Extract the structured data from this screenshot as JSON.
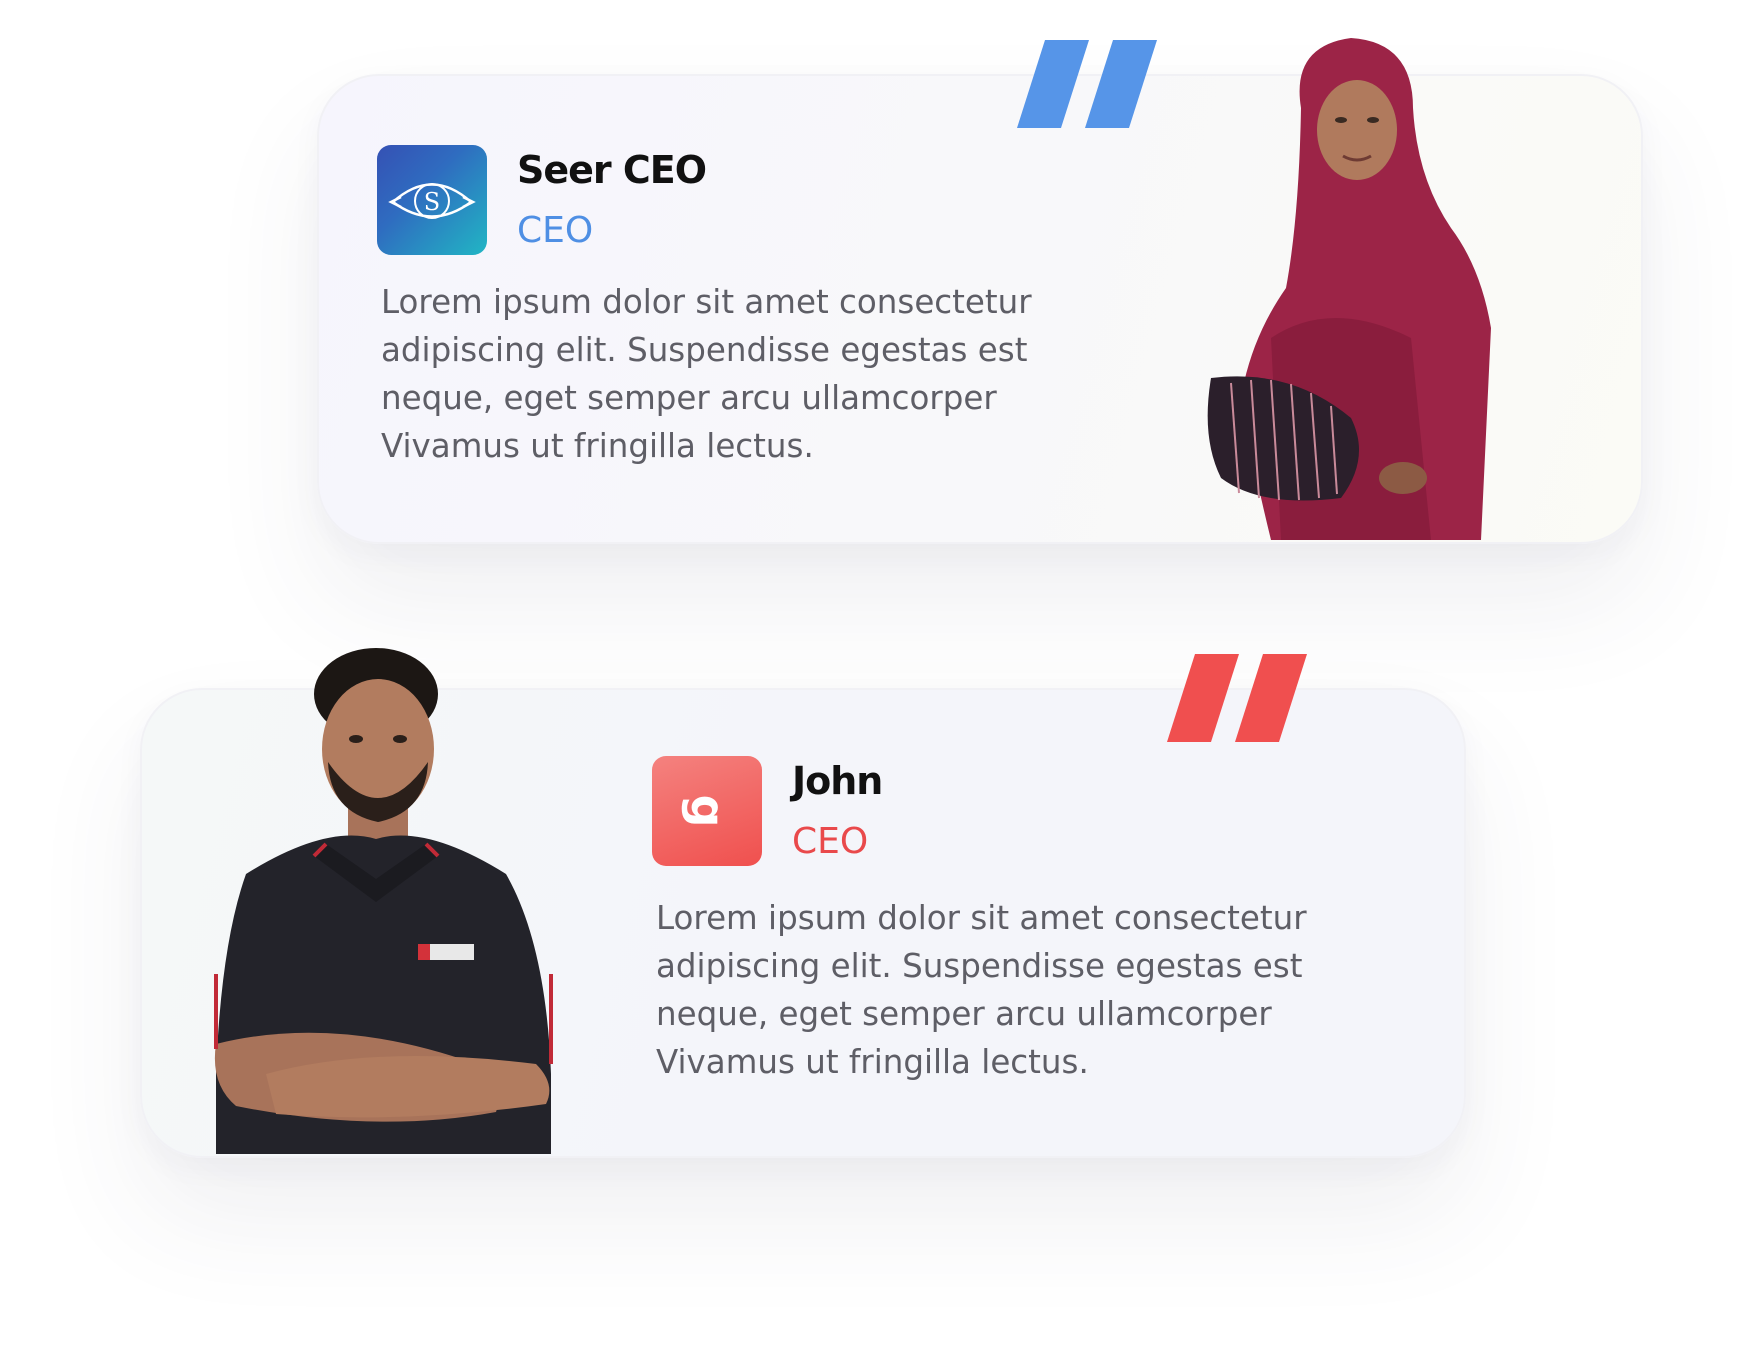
{
  "testimonials": [
    {
      "name": "Seer CEO",
      "role": "CEO",
      "quote": "Lorem ipsum dolor sit amet consectetur adipiscing elit. Suspendisse egestas est neque, eget semper arcu ullamcorper Vivamus ut fringilla lectus.",
      "logo_letter": "S",
      "accent_color": "#4f8fe4",
      "quote_icon": "quote-icon",
      "logo_icon": "eye-logo-icon"
    },
    {
      "name": "John",
      "role": "CEO",
      "quote": "Lorem ipsum dolor sit amet consectetur adipiscing elit. Suspendisse egestas est neque, eget semper arcu ullamcorper Vivamus ut fringilla lectus.",
      "logo_letter": "g",
      "accent_color": "#e9494b",
      "quote_icon": "quote-icon",
      "logo_icon": "g-logo-icon"
    }
  ]
}
